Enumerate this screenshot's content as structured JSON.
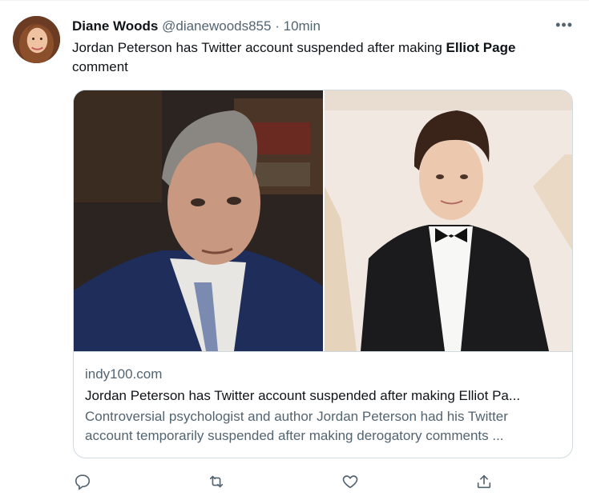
{
  "tweet": {
    "author_name": "Diane Woods",
    "author_handle": "@dianewoods855",
    "separator": "·",
    "time": "10min",
    "more_label": "•••",
    "text_before": "Jordan Peterson has Twitter account suspended after making ",
    "text_bold": "Elliot Page",
    "text_after": "comment"
  },
  "card": {
    "domain": "indy100.com",
    "title": "Jordan Peterson has Twitter account suspended after making Elliot Pa...",
    "description_line1": "Controversial psychologist and author Jordan Peterson had his Twitter",
    "description_line2": "account temporarily suspended after making derogatory comments ...",
    "images": [
      "photo-man-in-suit",
      "photo-person-in-tuxedo"
    ]
  },
  "actions": {
    "icons": [
      "reply-icon",
      "retweet-icon",
      "like-icon",
      "share-icon"
    ]
  },
  "colors": {
    "text_primary": "#0f1419",
    "text_secondary": "#536471",
    "border": "#cfd9de"
  }
}
